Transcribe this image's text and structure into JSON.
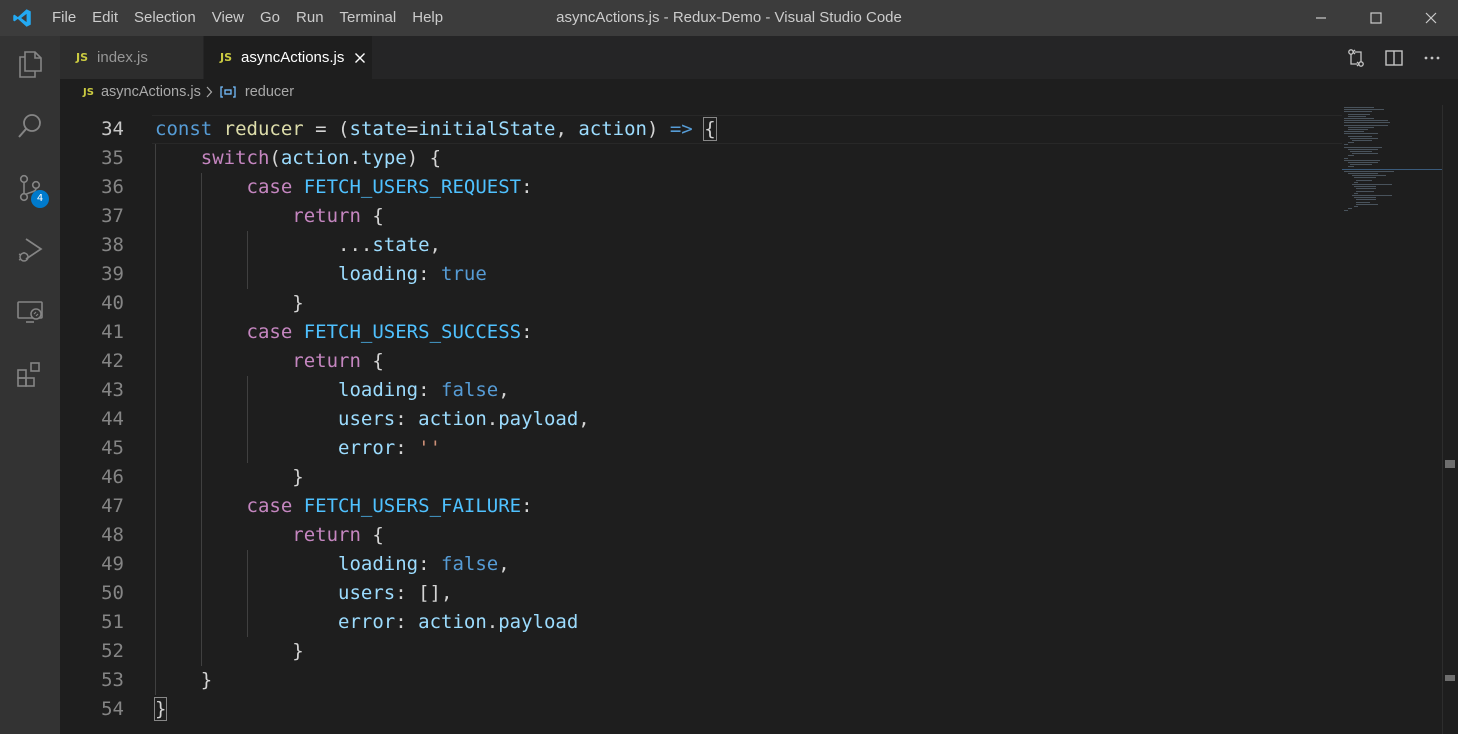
{
  "window": {
    "title": "asyncActions.js - Redux-Demo - Visual Studio Code",
    "menu": [
      "File",
      "Edit",
      "Selection",
      "View",
      "Go",
      "Run",
      "Terminal",
      "Help"
    ]
  },
  "activity_bar": {
    "items": [
      {
        "name": "explorer-icon"
      },
      {
        "name": "search-icon"
      },
      {
        "name": "source-control-icon",
        "badge": "4"
      },
      {
        "name": "run-debug-icon"
      },
      {
        "name": "remote-explorer-icon"
      },
      {
        "name": "extensions-icon"
      }
    ]
  },
  "tabs": [
    {
      "icon": "JS",
      "label": "index.js",
      "active": false
    },
    {
      "icon": "JS",
      "label": "asyncActions.js",
      "active": true
    }
  ],
  "breadcrumb": {
    "file_icon": "JS",
    "file": "asyncActions.js",
    "symbol": "reducer"
  },
  "editor": {
    "first_line_number": 34,
    "current_line": 34,
    "lines": [
      {
        "num": "34",
        "tokens": [
          [
            "kw",
            "const"
          ],
          [
            "op",
            " "
          ],
          [
            "fn",
            "reducer"
          ],
          [
            "op",
            " = ("
          ],
          [
            "pv",
            "state"
          ],
          [
            "op",
            "="
          ],
          [
            "pv",
            "initialState"
          ],
          [
            "op",
            ", "
          ],
          [
            "pv",
            "action"
          ],
          [
            "op",
            ") "
          ],
          [
            "kw",
            "=>"
          ],
          [
            "op",
            " "
          ],
          [
            "pn",
            "{"
          ]
        ]
      },
      {
        "num": "35",
        "tokens": [
          [
            "op",
            "    "
          ],
          [
            "ctl",
            "switch"
          ],
          [
            "op",
            "("
          ],
          [
            "pv",
            "action"
          ],
          [
            "op",
            "."
          ],
          [
            "pv",
            "type"
          ],
          [
            "op",
            ") {"
          ]
        ]
      },
      {
        "num": "36",
        "tokens": [
          [
            "op",
            "        "
          ],
          [
            "ctl",
            "case"
          ],
          [
            "op",
            " "
          ],
          [
            "cst",
            "FETCH_USERS_REQUEST"
          ],
          [
            "op",
            ":"
          ]
        ]
      },
      {
        "num": "37",
        "tokens": [
          [
            "op",
            "            "
          ],
          [
            "ctl",
            "return"
          ],
          [
            "op",
            " {"
          ]
        ]
      },
      {
        "num": "38",
        "tokens": [
          [
            "op",
            "                ..."
          ],
          [
            "pv",
            "state"
          ],
          [
            "op",
            ","
          ]
        ]
      },
      {
        "num": "39",
        "tokens": [
          [
            "op",
            "                "
          ],
          [
            "pv",
            "loading"
          ],
          [
            "op",
            ": "
          ],
          [
            "kw",
            "true"
          ]
        ]
      },
      {
        "num": "40",
        "tokens": [
          [
            "op",
            "            }"
          ]
        ]
      },
      {
        "num": "41",
        "tokens": [
          [
            "op",
            "        "
          ],
          [
            "ctl",
            "case"
          ],
          [
            "op",
            " "
          ],
          [
            "cst",
            "FETCH_USERS_SUCCESS"
          ],
          [
            "op",
            ":"
          ]
        ]
      },
      {
        "num": "42",
        "tokens": [
          [
            "op",
            "            "
          ],
          [
            "ctl",
            "return"
          ],
          [
            "op",
            " {"
          ]
        ]
      },
      {
        "num": "43",
        "tokens": [
          [
            "op",
            "                "
          ],
          [
            "pv",
            "loading"
          ],
          [
            "op",
            ": "
          ],
          [
            "kw",
            "false"
          ],
          [
            "op",
            ","
          ]
        ]
      },
      {
        "num": "44",
        "tokens": [
          [
            "op",
            "                "
          ],
          [
            "pv",
            "users"
          ],
          [
            "op",
            ": "
          ],
          [
            "pv",
            "action"
          ],
          [
            "op",
            "."
          ],
          [
            "pv",
            "payload"
          ],
          [
            "op",
            ","
          ]
        ]
      },
      {
        "num": "45",
        "tokens": [
          [
            "op",
            "                "
          ],
          [
            "pv",
            "error"
          ],
          [
            "op",
            ": "
          ],
          [
            "str",
            "''"
          ]
        ]
      },
      {
        "num": "46",
        "tokens": [
          [
            "op",
            "            }"
          ]
        ]
      },
      {
        "num": "47",
        "tokens": [
          [
            "op",
            "        "
          ],
          [
            "ctl",
            "case"
          ],
          [
            "op",
            " "
          ],
          [
            "cst",
            "FETCH_USERS_FAILURE"
          ],
          [
            "op",
            ":"
          ]
        ]
      },
      {
        "num": "48",
        "tokens": [
          [
            "op",
            "            "
          ],
          [
            "ctl",
            "return"
          ],
          [
            "op",
            " {"
          ]
        ]
      },
      {
        "num": "49",
        "tokens": [
          [
            "op",
            "                "
          ],
          [
            "pv",
            "loading"
          ],
          [
            "op",
            ": "
          ],
          [
            "kw",
            "false"
          ],
          [
            "op",
            ","
          ]
        ]
      },
      {
        "num": "50",
        "tokens": [
          [
            "op",
            "                "
          ],
          [
            "pv",
            "users"
          ],
          [
            "op",
            ": [],"
          ]
        ]
      },
      {
        "num": "51",
        "tokens": [
          [
            "op",
            "                "
          ],
          [
            "pv",
            "error"
          ],
          [
            "op",
            ": "
          ],
          [
            "pv",
            "action"
          ],
          [
            "op",
            "."
          ],
          [
            "pv",
            "payload"
          ]
        ]
      },
      {
        "num": "52",
        "tokens": [
          [
            "op",
            "            }"
          ]
        ]
      },
      {
        "num": "53",
        "tokens": [
          [
            "op",
            "    }"
          ]
        ]
      },
      {
        "num": "54",
        "tokens": [
          [
            "pn",
            "}"
          ]
        ]
      }
    ]
  },
  "colors": {
    "accent": "#007acc",
    "titlebar": "#3c3c3c",
    "activitybar": "#333333",
    "editor_bg": "#1e1e1e"
  }
}
